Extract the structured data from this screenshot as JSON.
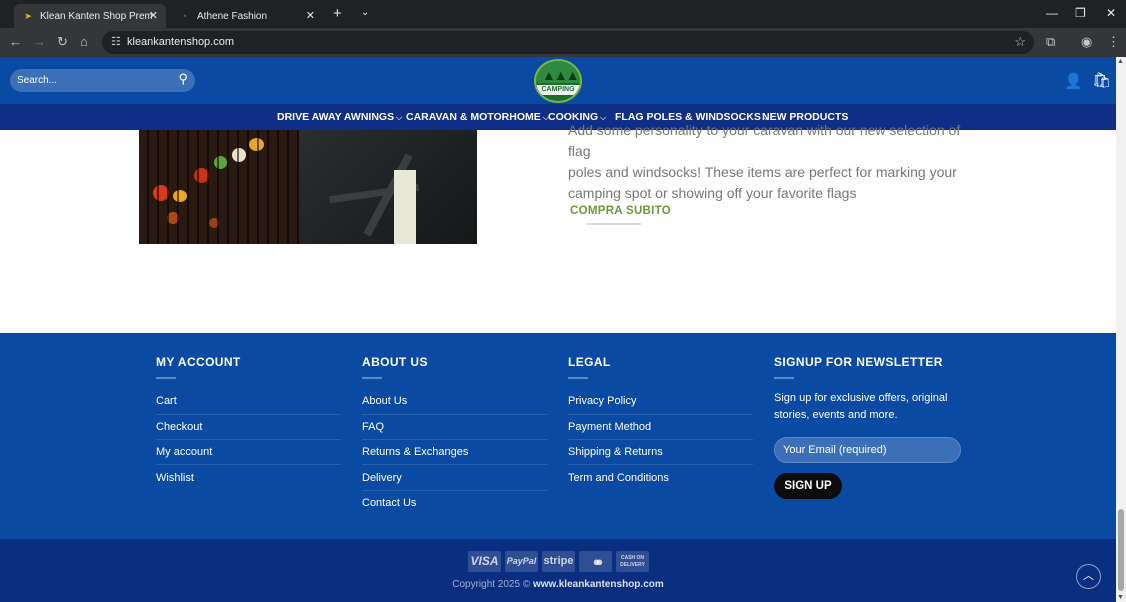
{
  "browser": {
    "tabs": [
      {
        "title": "Klean Kanten Shop Premium C",
        "active": true
      },
      {
        "title": "Athene Fashion",
        "active": false
      }
    ],
    "url": "kleankantenshop.com"
  },
  "header": {
    "search_placeholder": "Search...",
    "logo_text": "CAMPING"
  },
  "nav": {
    "items": [
      {
        "label": "DRIVE AWAY AWNINGS",
        "dropdown": true
      },
      {
        "label": "CARAVAN & MOTORHOME",
        "dropdown": true
      },
      {
        "label": "COOKING",
        "dropdown": true
      },
      {
        "label": "FLAG POLES & WINDSOCKS",
        "dropdown": true
      },
      {
        "label": "NEW PRODUCTS",
        "dropdown": false
      }
    ]
  },
  "promo": {
    "line1": "Add some personality to your caravan with our new selection of flag",
    "line2": "poles and windsocks! These items are perfect for marking your",
    "line3": "camping spot or showing off your favorite flags",
    "cta": "COMPRA SUBITO"
  },
  "footer": {
    "my_account": {
      "title": "MY ACCOUNT",
      "links": [
        "Cart",
        "Checkout",
        "My account",
        "Wishlist"
      ]
    },
    "about_us": {
      "title": "ABOUT US",
      "links": [
        "About Us",
        "FAQ",
        "Returns & Exchanges",
        "Delivery",
        "Contact Us"
      ]
    },
    "legal": {
      "title": "LEGAL",
      "links": [
        "Privacy Policy",
        "Payment Method",
        "Shipping & Returns",
        "Term and Conditions"
      ]
    },
    "newsletter": {
      "title": "SIGNUP FOR NEWSLETTER",
      "text": "Sign up for exclusive offers, original stories, events and more.",
      "input_placeholder": "Your Email (required)",
      "button": "SIGN UP"
    }
  },
  "bottom": {
    "payments": [
      "VISA",
      "PayPal",
      "stripe",
      "mastercard",
      "CASH ON DELIVERY"
    ],
    "copyright_prefix": "Copyright 2025 ©",
    "copyright_site": "www.kleankantenshop.com"
  },
  "colors": {
    "header_blue": "#0a4aa3",
    "nav_blue": "#0f2f86",
    "footer_blue": "#0a4aa3",
    "bottom_blue": "#0b2f80",
    "cta_green": "#6a9a3a"
  }
}
